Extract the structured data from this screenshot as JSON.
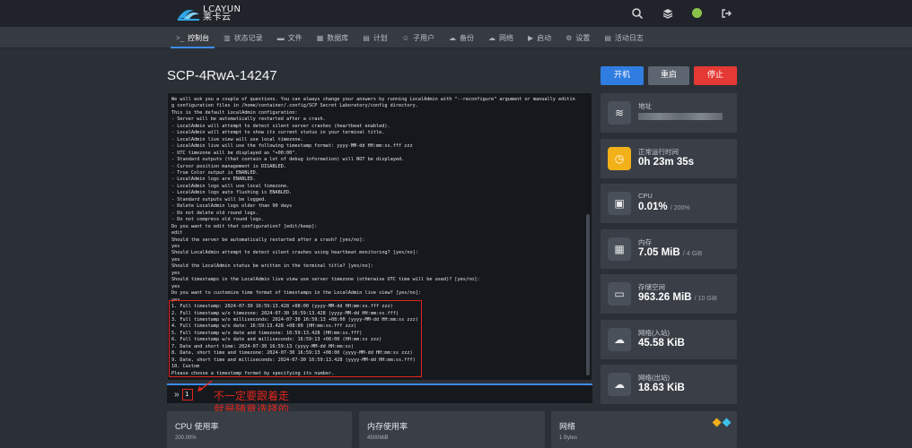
{
  "header": {
    "logo_text_top": "LCAYUN",
    "logo_text_bottom": "莱卡云",
    "icons": [
      "search-icon",
      "layers-icon",
      "status-indicator",
      "logout-icon"
    ],
    "status_color": "#8bc34a"
  },
  "nav": {
    "items": [
      {
        "icon": ">_",
        "label": "控制台",
        "active": true
      },
      {
        "icon": "▥",
        "label": "状态记录"
      },
      {
        "icon": "▬",
        "label": "文件"
      },
      {
        "icon": "▦",
        "label": "数据库"
      },
      {
        "icon": "▤",
        "label": "计划"
      },
      {
        "icon": "☺",
        "label": "子用户"
      },
      {
        "icon": "☁",
        "label": "备份"
      },
      {
        "icon": "☁",
        "label": "网络"
      },
      {
        "icon": "▶",
        "label": "启动"
      },
      {
        "icon": "⚙",
        "label": "设置"
      },
      {
        "icon": "▤",
        "label": "活动日志"
      }
    ]
  },
  "server": {
    "name": "SCP-4RwA-14247",
    "buttons": {
      "start": "开机",
      "restart": "重启",
      "stop": "停止"
    }
  },
  "terminal": {
    "lines": [
      "We will ask you a couple of questions. You can always change your answers by running LocalAdmin with \"--reconfigure\" argument or manually editin",
      "g configuration files in /home/container/.config/SCP Secret Laboratory/config directory.",
      "This is the default LocalAdmin configuration:",
      "- Server will be automatically restarted after a crash.",
      "- LocalAdmin will attempt to detect silent server crashes (heartbeat enabled).",
      "- LocalAdmin will attempt to show its current status in your terminal title.",
      "- LocalAdmin live view will use local timezone.",
      "- LocalAdmin live will use the following timestamp format: yyyy-MM-dd HH:mm:ss.fff zzz",
      "- UTC timezone will be displayed as \"+00:00\".",
      "- Standard outputs (that contain a lot of debug information) will NOT be displayed.",
      "- Cursor position management is DISABLED.",
      "- True Color output is ENABLED.",
      "- LocalAdmin logs are ENABLED.",
      "- LocalAdmin logs will use local timezone.",
      "- LocalAdmin logs auto flushing is ENABLED.",
      "- Standard outputs will be logged.",
      "- Delete LocalAdmin logs older than 90 days",
      "- Do not delete old round logs.",
      "- Do not compress old round logs.",
      "Do you want to edit that configuration? [edit/keep]:",
      "edit",
      "Should the server be automatically restarted after a crash? [yes/no]:",
      "yes",
      "Should LocalAdmin attempt to detect silent crashes using heartbeat monitoring? [yes/no]:",
      "yes",
      "Should the LocalAdmin status be written in the terminal title? [yes/no]:",
      "yes",
      "Should timestamps in the LocalAdmin live view use server timezone (otherwise UTC time will be used)? [yes/no]:",
      "yes",
      "Do you want to customize time format of timestamps in the LocalAdmin live view? [yes/no]:",
      "yes",
      "1. Full timestamp: 2024-07-30 16:59:13.428 +08:00 (yyyy-MM-dd HH:mm:ss.fff zzz)",
      "2. Full timestamp w/o timezone: 2024-07-30 16:59:13.428 (yyyy-MM-dd HH:mm:ss.fff)",
      "3. Full timestamp w/o milliseconds: 2024-07-30 16:59:13 +08:00 (yyyy-MM-dd HH:mm:ss zzz)",
      "4. Full timestamp w/o date: 16:59:13.428 +08:00 (HH:mm:ss.fff zzz)",
      "5. Full timestamp w/o date and timezone: 16:59:13.428 (HH:mm:ss.fff)",
      "6. Full timestamp w/o date and milliseconds: 16:59:13 +08:00 (HH:mm:ss zzz)",
      "7. Date and short time: 2024-07-30 16:59:13 (yyyy-MM-dd HH:mm:ss)",
      "8. Date, short time and timezone: 2024-07-30 16:59:13 +08:00 (yyyy-MM-dd HH:mm:ss zzz)",
      "9. Date, short time and milliseconds: 2024-07-30 16:59:13.428 (yyyy-MM-dd HH:mm:ss.fff)",
      "10. Custom",
      "Please choose a timestamp format by specifying its number."
    ],
    "input_value": "1",
    "annotation": [
      "不一定要跟着走",
      "就是随意选择的"
    ],
    "annotation_color": "#e0271f"
  },
  "cards": [
    {
      "icon": "wifi-icon",
      "glyph": "≋",
      "label": "地址",
      "value": "",
      "sub": ""
    },
    {
      "icon": "clock-icon",
      "glyph": "◷",
      "label": "正常运行时间",
      "value": "0h 23m 35s",
      "sub": "",
      "accent": "#f2b019"
    },
    {
      "icon": "cpu-icon",
      "glyph": "▣",
      "label": "CPU",
      "value": "0.01%",
      "sub": "/ 200%"
    },
    {
      "icon": "memory-icon",
      "glyph": "▦",
      "label": "内存",
      "value": "7.05 MiB",
      "sub": "/ 4 GiB"
    },
    {
      "icon": "disk-icon",
      "glyph": "▭",
      "label": "存储空间",
      "value": "963.26 MiB",
      "sub": "/ 10 GiB"
    },
    {
      "icon": "cloud-download-icon",
      "glyph": "☁",
      "label": "网络(入站)",
      "value": "45.58 KiB",
      "sub": ""
    },
    {
      "icon": "cloud-upload-icon",
      "glyph": "☁",
      "label": "网络(出站)",
      "value": "18.63 KiB",
      "sub": ""
    }
  ],
  "panels": [
    {
      "title": "CPU 使用率",
      "sub": "200.00%"
    },
    {
      "title": "内存使用率",
      "sub": "4500MiB"
    },
    {
      "title": "网络",
      "sub": "1 Bytes",
      "legend_colors": [
        "#f2b019",
        "#3cc2e8"
      ]
    }
  ]
}
